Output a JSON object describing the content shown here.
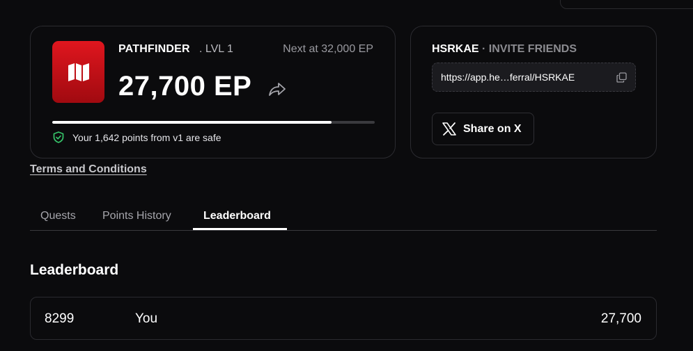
{
  "rank": {
    "title": "PATHFINDER",
    "level": ". LVL 1",
    "next_at": "Next at 32,000 EP",
    "ep": "27,700 EP",
    "progress": 0.8656,
    "safe_text": "Your 1,642 points from v1 are safe",
    "badge_icon": "map-icon",
    "share_icon": "share-arrow-icon",
    "safe_icon": "shield-check-icon",
    "accent_color": "#d8111a"
  },
  "invite": {
    "code": "HSRKAE",
    "label": " · INVITE FRIENDS",
    "link": "https://app.he…ferral/HSRKAE",
    "copy_icon": "copy-icon",
    "share_label": "Share on X",
    "share_icon": "x-logo-icon"
  },
  "terms_label": "Terms and Conditions",
  "tabs": [
    {
      "label": "Quests",
      "active": false
    },
    {
      "label": "Points History",
      "active": false
    },
    {
      "label": "Leaderboard",
      "active": true
    }
  ],
  "leaderboard": {
    "title": "Leaderboard",
    "rows": [
      {
        "rank": "8299",
        "name": "You",
        "points": "27,700"
      }
    ]
  }
}
